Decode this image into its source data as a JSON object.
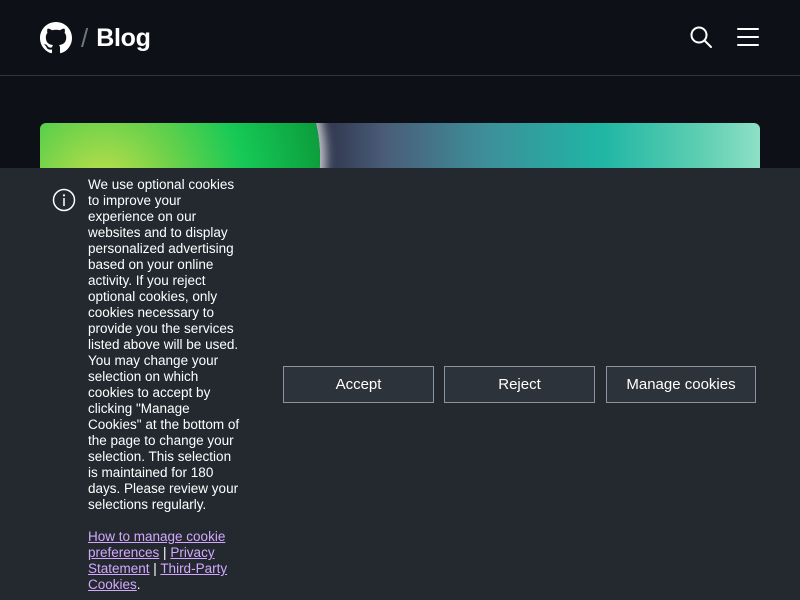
{
  "header": {
    "separator": "/",
    "title": "Blog",
    "icons": {
      "logo": "github-logo-icon",
      "search": "search-icon",
      "menu": "hamburger-menu-icon"
    }
  },
  "cookie_banner": {
    "icon": "info-icon",
    "message": "We use optional cookies to improve your experience on our websites and to display personalized advertising based on your online activity. If you reject optional cookies, only cookies necessary to provide you the services listed above will be used. You may change your selection on which cookies to accept by clicking \"Manage Cookies\" at the bottom of the page to change your selection. This selection is maintained for 180 days. Please review your selections regularly.",
    "links": {
      "manage_prefs": "How to manage cookie preferences",
      "sep1": " | ",
      "privacy": "Privacy Statement",
      "sep2": " | ",
      "third_party": "Third-Party Cookies",
      "end": "."
    },
    "buttons": {
      "accept": "Accept",
      "reject": "Reject",
      "manage": "Manage cookies"
    }
  },
  "colors": {
    "page_bg": "#0d1117",
    "banner_bg": "#24292f",
    "link": "#d2a8ff",
    "button_border": "#8b949e"
  }
}
